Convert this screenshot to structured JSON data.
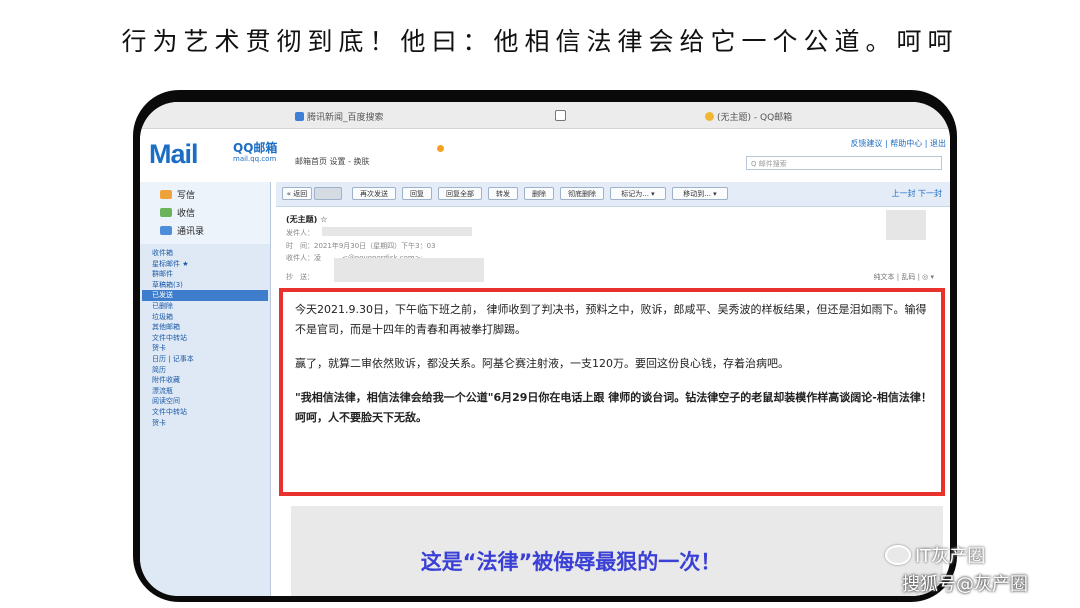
{
  "headline": "行为艺术贯彻到底！他曰：他相信法律会给它一个公道。呵呵",
  "browser": {
    "tabs": [
      {
        "label": "腾讯新闻_百度搜索",
        "icon": "qq-icon"
      },
      {
        "label": "",
        "icon": "page-icon"
      },
      {
        "label": "(无主题) - QQ邮箱",
        "icon": "qqmail-icon"
      }
    ]
  },
  "mail": {
    "logo": "Mail",
    "logo_brand": "QQ邮箱",
    "logo_domain": "mail.qq.com",
    "top_nav": "邮箱首页  设置 - 换肤",
    "top_links": "反馈建议 | 帮助中心 | 退出",
    "search_placeholder": "Q 邮件搜索",
    "quick": [
      {
        "label": "写信",
        "icon": "pen-icon"
      },
      {
        "label": "收信",
        "icon": "inbox-icon"
      },
      {
        "label": "通讯录",
        "icon": "contacts-icon"
      }
    ],
    "folders": [
      "收件箱",
      "星标邮件 ★",
      "群邮件",
      "草稿箱(3)",
      "已发送",
      "已删除",
      "垃圾箱",
      "其他邮箱",
      "文件中转站",
      "贺卡",
      "日历 | 记事本",
      "简历",
      "附件收藏",
      "漂流瓶",
      "阅读空间",
      "文件中转站",
      "贺卡"
    ],
    "selected_folder": "已发送",
    "toolbar": [
      {
        "label": "« 返回"
      },
      {
        "label": "再次发送"
      },
      {
        "label": "回复"
      },
      {
        "label": "回复全部"
      },
      {
        "label": "转发"
      },
      {
        "label": "删除"
      },
      {
        "label": "彻底删除"
      },
      {
        "label": "标记为... ▾"
      },
      {
        "label": "移动到... ▾"
      }
    ],
    "pager": "上一封  下一封",
    "subject": "(无主题) ☆",
    "meta": {
      "sender": "发件人：",
      "time": "时　间：2021年9月30日（星期四）下午3：03",
      "recipient": "收件人：凌　　　<@novonordisk.com>;",
      "cc": "抄　送："
    },
    "plain_text_link": "纯文本 | 乱码 | ◎ ▾",
    "body": [
      "今天2021.9.30日，下午临下班之前，  律师收到了判决书，预料之中，败诉，郎咸平、吴秀波的样板结果，但还是泪如雨下。输得不是官司，而是十四年的青春和再被拳打脚踢。",
      "赢了，就算二审依然败诉，都没关系。阿基仑赛注射液，一支120万。要回这份良心钱，存着治病吧。",
      "\"我相信法律，相信法律会给我一个公道\"6月29日你在电话上跟  律师的谈台词。钻法律空子的老鼠却装模作样高谈阔论-相信法律！呵呵，人不要脸天下无敌。"
    ]
  },
  "caption": "这是“法律”被侮辱最狠的一次！",
  "watermark": {
    "line1": "IT灰产圈",
    "line2": "搜狐号@灰产圈"
  },
  "colors": {
    "highlight_border": "#e8312c",
    "caption": "#3a40d6",
    "brand": "#1c6ec4"
  }
}
